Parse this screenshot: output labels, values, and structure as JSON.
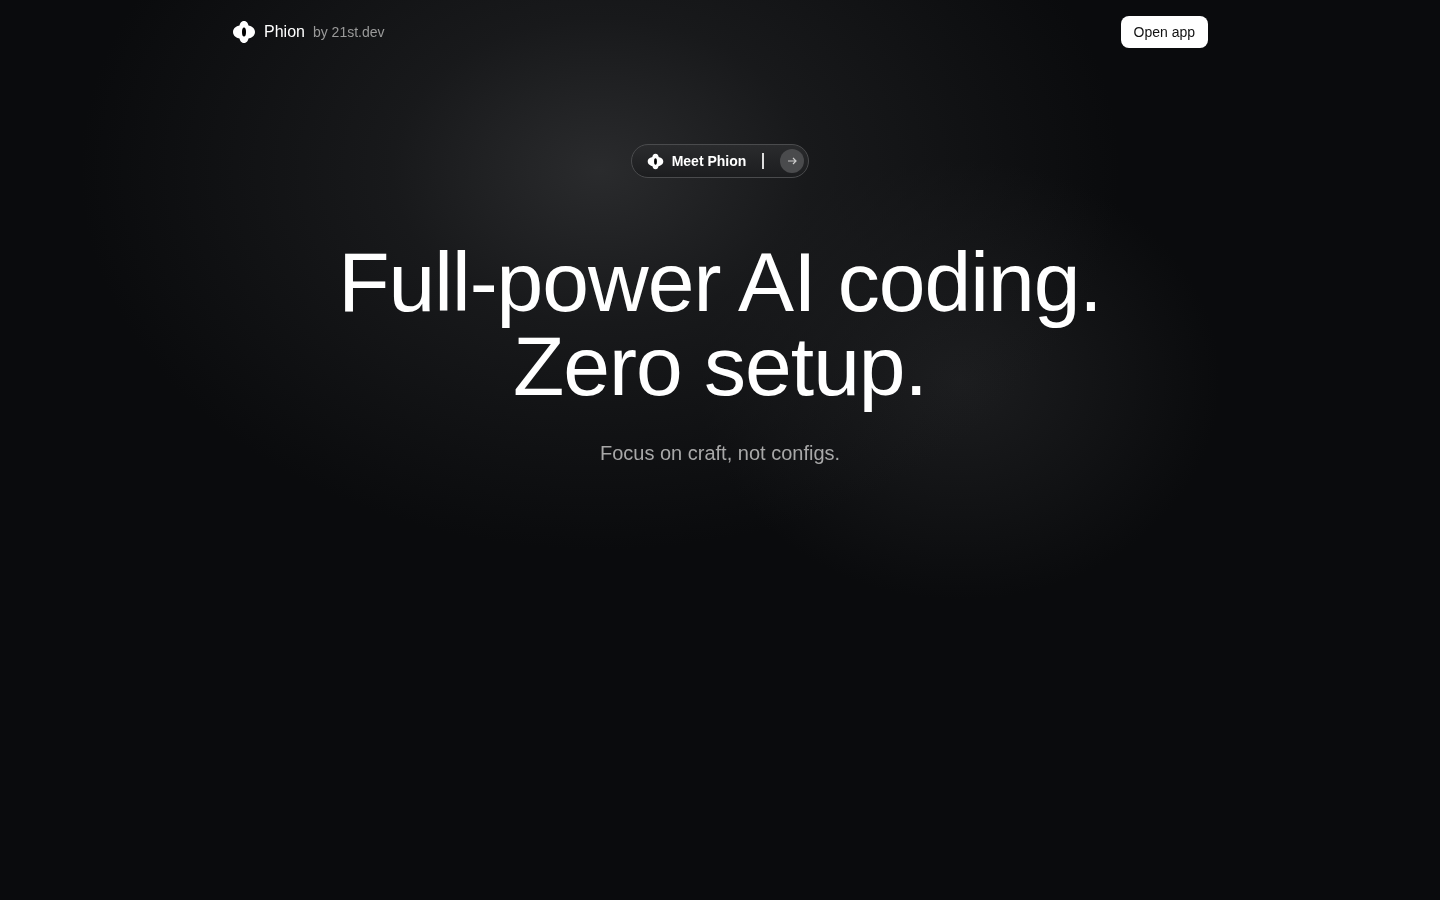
{
  "header": {
    "brand": "Phion",
    "byline": "by 21st.dev",
    "button": "Open app"
  },
  "hero": {
    "pill": {
      "label": "Meet Phion"
    },
    "headline": [
      "Full-power AI coding.",
      "Zero setup."
    ],
    "subtitle": "Focus on craft, not configs."
  }
}
